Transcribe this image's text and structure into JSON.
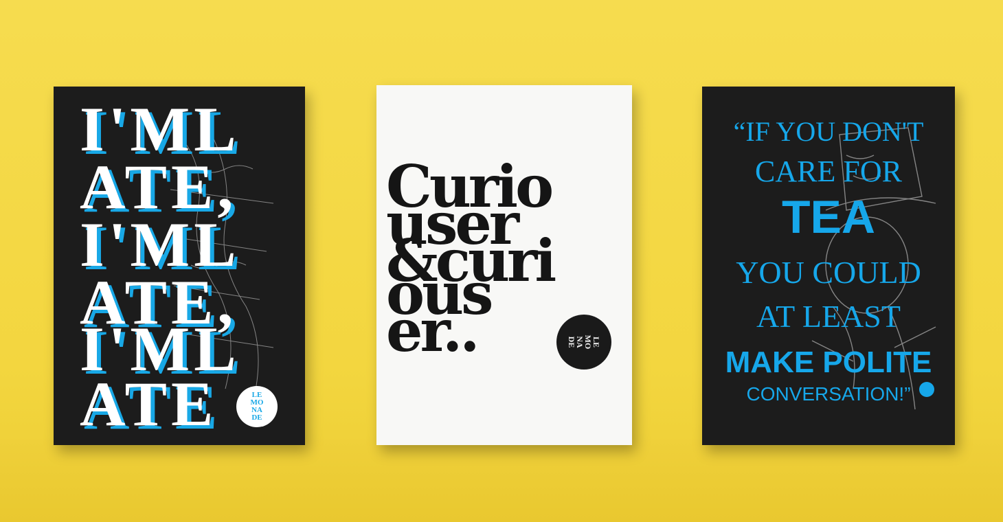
{
  "scene": {
    "background": "#f4d843",
    "accent_blue": "#18a8e6",
    "poster_dark": "#1c1c1c",
    "poster_light": "#f8f8f6"
  },
  "poster_left": {
    "lines": [
      "I'ML",
      "ATE,",
      "I'ML",
      "ATE,",
      "I'ML",
      "ATE"
    ],
    "logo_lines": [
      "LE",
      "MO",
      "NA",
      "DE"
    ]
  },
  "poster_center": {
    "lines": [
      "Curio",
      "user",
      "&curi",
      "ous",
      "er.."
    ],
    "logo_lines": [
      "LE",
      "MO",
      "NA",
      "DE"
    ]
  },
  "poster_right": {
    "quote": [
      "“IF YOU DON'T",
      "CARE FOR",
      "TEA",
      "YOU COULD",
      "AT LEAST",
      "MAKE POLITE",
      "CONVERSATION!”"
    ]
  }
}
